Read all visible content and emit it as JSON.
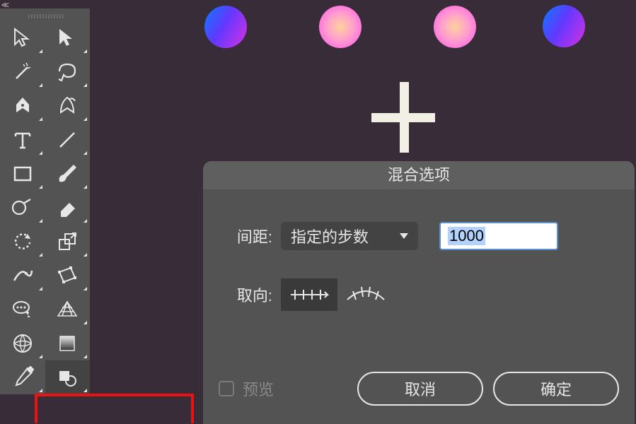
{
  "dialog": {
    "title": "混合选项",
    "spacing_label": "间距:",
    "spacing_mode": "指定的步数",
    "spacing_value": "1000",
    "orientation_label": "取向:",
    "preview_label": "预览",
    "cancel": "取消",
    "ok": "确定"
  },
  "tools": {
    "left": [
      "selection",
      "magic-wand",
      "pen",
      "type",
      "rectangle",
      "shape-builder",
      "rotate",
      "curvature",
      "comment",
      "mesh",
      "eyedropper"
    ],
    "right": [
      "direct-selection",
      "lasso",
      "pencil",
      "line",
      "brush",
      "eraser",
      "artboard",
      "free-transform",
      "perspective-grid",
      "gradient",
      "shapes"
    ]
  }
}
